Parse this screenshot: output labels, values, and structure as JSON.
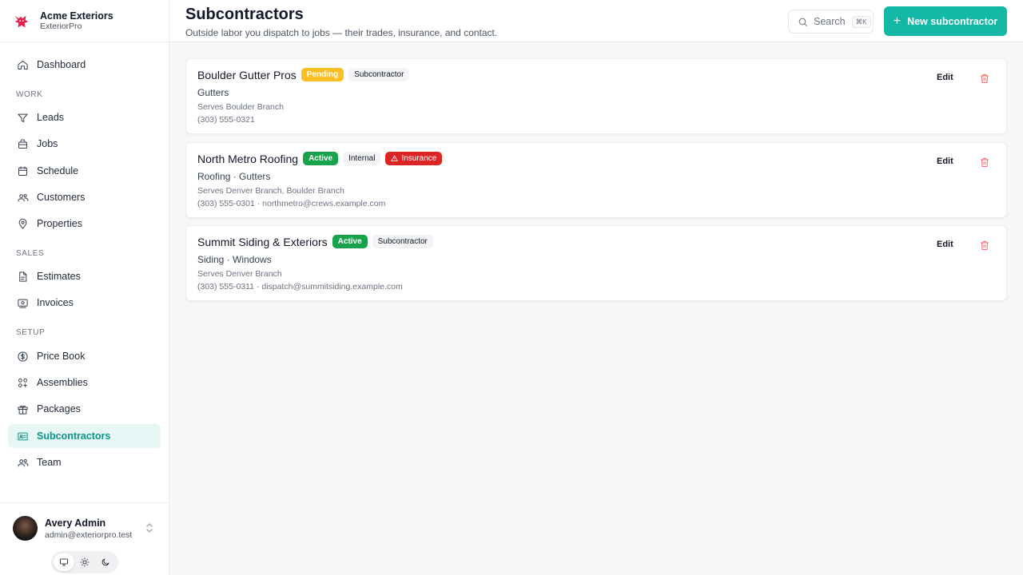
{
  "app": {
    "name": "Acme Exteriors",
    "product": "ExteriorPro"
  },
  "sidebar": {
    "dashboard": "Dashboard",
    "sections": [
      {
        "label": "WORK",
        "items": [
          "Leads",
          "Jobs",
          "Schedule",
          "Customers",
          "Properties"
        ]
      },
      {
        "label": "SALES",
        "items": [
          "Estimates",
          "Invoices"
        ]
      },
      {
        "label": "SETUP",
        "items": [
          "Price Book",
          "Assemblies",
          "Packages",
          "Subcontractors",
          "Team"
        ]
      }
    ],
    "active_item": "Subcontractors"
  },
  "user": {
    "name": "Avery Admin",
    "email": "admin@exteriorpro.test"
  },
  "header": {
    "title": "Subcontractors",
    "subtitle": "Outside labor you dispatch to jobs — their trades, insurance, and contact.",
    "search_label": "Search",
    "search_shortcut": "⌘K",
    "new_button": "New subcontractor"
  },
  "subcontractors": [
    {
      "name": "Boulder Gutter Pros",
      "status": "Pending",
      "type": "Subcontractor",
      "warning": "",
      "trades": "Gutters",
      "serves": "Serves Boulder Branch",
      "contact": "(303) 555-0321"
    },
    {
      "name": "North Metro Roofing",
      "status": "Active",
      "type": "Internal",
      "warning": "Insurance",
      "trades": "Roofing · Gutters",
      "serves": "Serves Denver Branch, Boulder Branch",
      "contact": "(303) 555-0301 · northmetro@crews.example.com"
    },
    {
      "name": "Summit Siding & Exteriors",
      "status": "Active",
      "type": "Subcontractor",
      "warning": "",
      "trades": "Siding · Windows",
      "serves": "Serves Denver Branch",
      "contact": "(303) 555-0311 · dispatch@summitsiding.example.com"
    }
  ],
  "card_actions": {
    "edit": "Edit"
  },
  "colors": {
    "accent": "#14b8a6",
    "active_nav_bg": "#e6f7f6",
    "pending": "#fbbf24",
    "active": "#16a34a",
    "danger": "#dc2626"
  }
}
